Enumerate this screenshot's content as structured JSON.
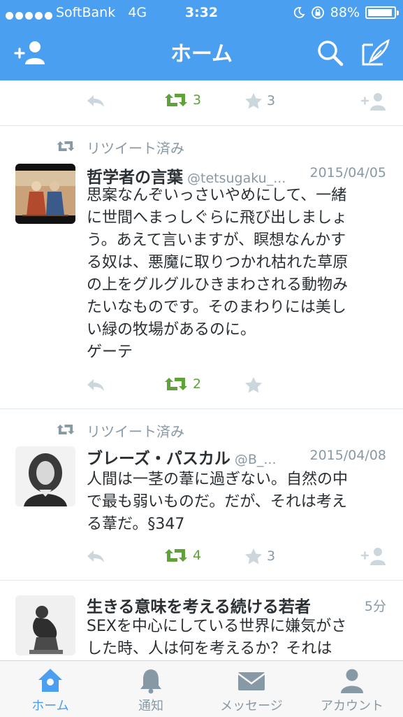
{
  "status_bar": {
    "carrier": "SoftBank",
    "network": "4G",
    "time": "3:32",
    "battery": "88%",
    "battery_level": 0.88
  },
  "nav": {
    "title": "ホーム",
    "left_icon": "add-user-icon",
    "right_icons": [
      "search-icon",
      "compose-icon"
    ]
  },
  "tweets": [
    {
      "partial": true,
      "actions": {
        "retweets": "3",
        "favorites": "3"
      }
    },
    {
      "retweeted_label": "リツイート済み",
      "name": "哲学者の言葉",
      "handle": "@tetsugaku_...",
      "date": "2015/04/05",
      "text": "思案なんぞいっさいやめにして、一緒\nに世間へまっしぐらに飛び出しましょ\nう。あえて言いますが、瞑想なんかす\nる奴は、悪魔に取りつかれ枯れた草原\nの上をグルグルひきまわされる動物み\nたいなものです。そのまわりには美し\nい緑の牧場があるのに。\nゲーテ",
      "actions": {
        "retweets": "2",
        "favorites": ""
      }
    },
    {
      "retweeted_label": "リツイート済み",
      "name": "ブレーズ・パスカル",
      "handle": "@B_...",
      "date": "2015/04/08",
      "text": "人間は一茎の葦に過ぎない。自然の中\nで最も弱いものだ。だが、それは考え\nる葦だ。§347",
      "actions": {
        "retweets": "4",
        "favorites": "3"
      }
    },
    {
      "name": "生きる意味を考える続ける若者",
      "date": "5分",
      "text": "SEXを中心にしている世界に嫌気がさ\nした時、人は何を考えるか？それは"
    }
  ],
  "tabbar": {
    "tabs": [
      {
        "label": "ホーム",
        "icon": "home-icon",
        "active": true
      },
      {
        "label": "通知",
        "icon": "bell-icon",
        "active": false
      },
      {
        "label": "メッセージ",
        "icon": "envelope-icon",
        "active": false
      },
      {
        "label": "アカウント",
        "icon": "person-icon",
        "active": false
      }
    ]
  },
  "colors": {
    "brand": "#4a9ff0",
    "retweet_green": "#5fa23a",
    "muted": "#8899a6",
    "text": "#292f33"
  }
}
